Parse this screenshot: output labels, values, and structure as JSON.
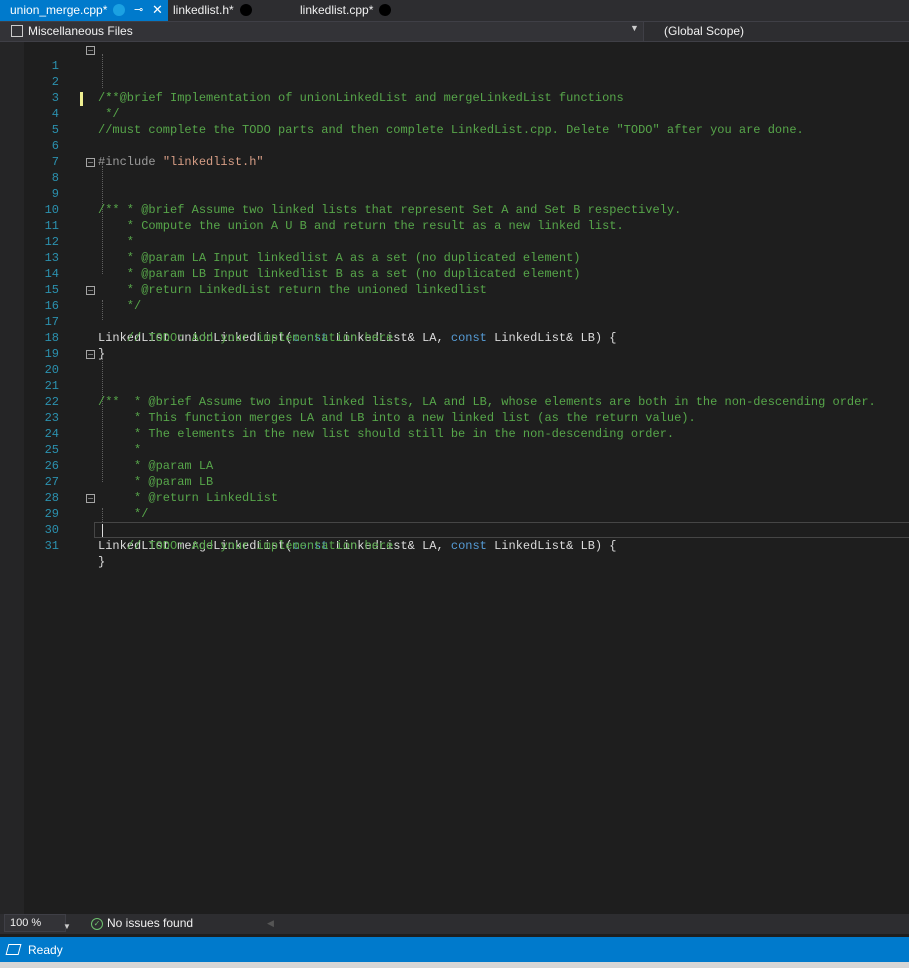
{
  "tabs": [
    {
      "label": "union_merge.cpp*",
      "active": true
    },
    {
      "label": "linkedlist.h*",
      "active": false
    },
    {
      "label": "linkedlist.cpp*",
      "active": false
    }
  ],
  "tab_icons": {
    "pin": "⊸",
    "close": "✕"
  },
  "navbar": {
    "file": "Miscellaneous Files",
    "scope": "(Global Scope)"
  },
  "editor": {
    "line_numbers": [
      "1",
      "2",
      "3",
      "4",
      "5",
      "6",
      "7",
      "8",
      "9",
      "10",
      "11",
      "12",
      "13",
      "14",
      "15",
      "16",
      "17",
      "18",
      "19",
      "20",
      "21",
      "22",
      "23",
      "24",
      "25",
      "26",
      "27",
      "28",
      "29",
      "30",
      "31"
    ],
    "lines": {
      "l1": "/**",
      "l2": " * @brief Implementation of unionLinkedList and mergeLinkedList functions",
      "l3": " */",
      "l4": "//must complete the TODO parts and then complete LinkedList.cpp. Delete \"TODO\" after you are done.",
      "l6_pre": "#include ",
      "l6_str": "\"linkedlist.h\"",
      "l8": "/**",
      "l9": "    * @brief Assume two linked lists that represent Set A and Set B respectively.",
      "l10": "    * Compute the union A U B and return the result as a new linked list.",
      "l11": "    *",
      "l12": "    * @param LA Input linkedlist A as a set (no duplicated element)",
      "l13": "    * @param LB Input linkedlist B as a set (no duplicated element)",
      "l14": "    * @return LinkedList return the unioned linkedlist",
      "l15": "    */",
      "l16_a": "LinkedList unionLinkedList(",
      "l16_kw1": "const",
      "l16_b": " LinkedList& LA, ",
      "l16_kw2": "const",
      "l16_c": " LinkedList& LB) {",
      "l17": "    // TODO: Add your implementation here",
      "l18": "}",
      "l20": "/**",
      "l21": "     * @brief Assume two input linked lists, LA and LB, whose elements are both in the non-descending order.",
      "l22": "     * This function merges LA and LB into a new linked list (as the return value).",
      "l23": "     * The elements in the new list should still be in the non-descending order.",
      "l24": "     *",
      "l25": "     * @param LA",
      "l26": "     * @param LB",
      "l27": "     * @return LinkedList",
      "l28": "     */",
      "l29_a": "LinkedList mergeLinkedList(",
      "l29_kw1": "const",
      "l29_b": " LinkedList& LA, ",
      "l29_kw2": "const",
      "l29_c": " LinkedList& LB) {",
      "l30": "    // TODO: Add your implementation here",
      "l31": "}"
    }
  },
  "status_strip": {
    "zoom": "100 %",
    "issues": "No issues found"
  },
  "statusbar": {
    "text": "Ready"
  },
  "colors": {
    "accent": "#007acc",
    "comment": "#57a64a",
    "keyword": "#569cd6",
    "string": "#d69d85",
    "line_number": "#2b91af"
  }
}
